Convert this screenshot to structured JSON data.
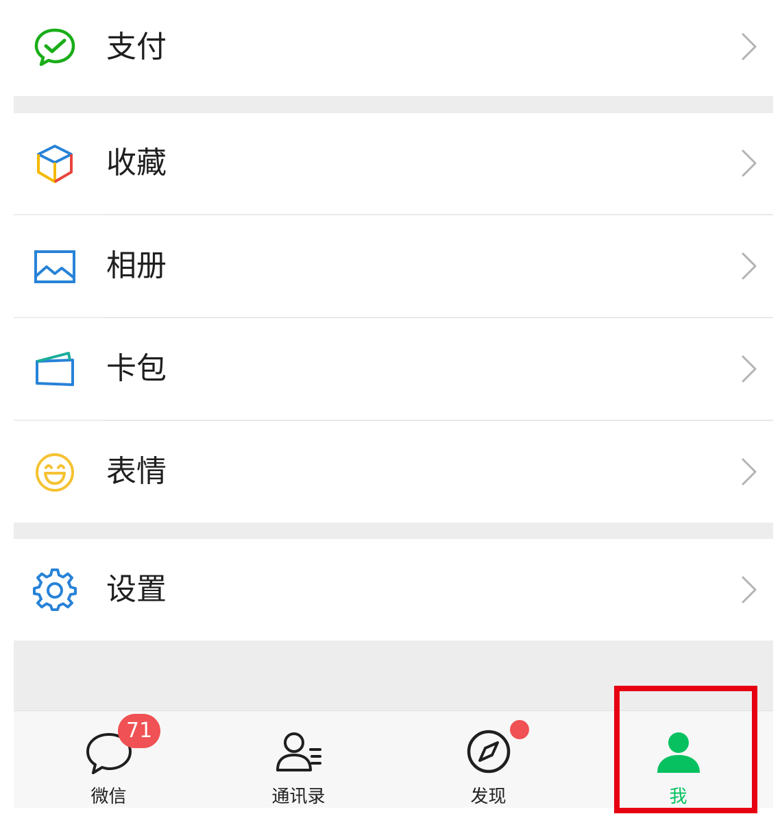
{
  "menu": {
    "items": [
      {
        "label": "支付",
        "icon": "wechat-pay-icon"
      },
      {
        "label": "收藏",
        "icon": "favorites-cube-icon"
      },
      {
        "label": "相册",
        "icon": "album-picture-icon"
      },
      {
        "label": "卡包",
        "icon": "card-wallet-icon"
      },
      {
        "label": "表情",
        "icon": "sticker-smile-icon"
      },
      {
        "label": "设置",
        "icon": "settings-gear-icon"
      }
    ],
    "chevron_icon": "chevron-right-icon"
  },
  "tabbar": {
    "tabs": [
      {
        "label": "微信",
        "icon": "chat-bubble-icon",
        "badge": "71"
      },
      {
        "label": "通讯录",
        "icon": "contacts-icon"
      },
      {
        "label": "发现",
        "icon": "compass-icon",
        "dot": true
      },
      {
        "label": "我",
        "icon": "person-icon",
        "active": true
      }
    ]
  },
  "colors": {
    "active_green": "#07c160",
    "badge_red": "#f05154",
    "highlight_red": "#e60012",
    "pay_green": "#1aad19",
    "icon_blue": "#2782d7",
    "smile_yellow": "#f5c232"
  }
}
